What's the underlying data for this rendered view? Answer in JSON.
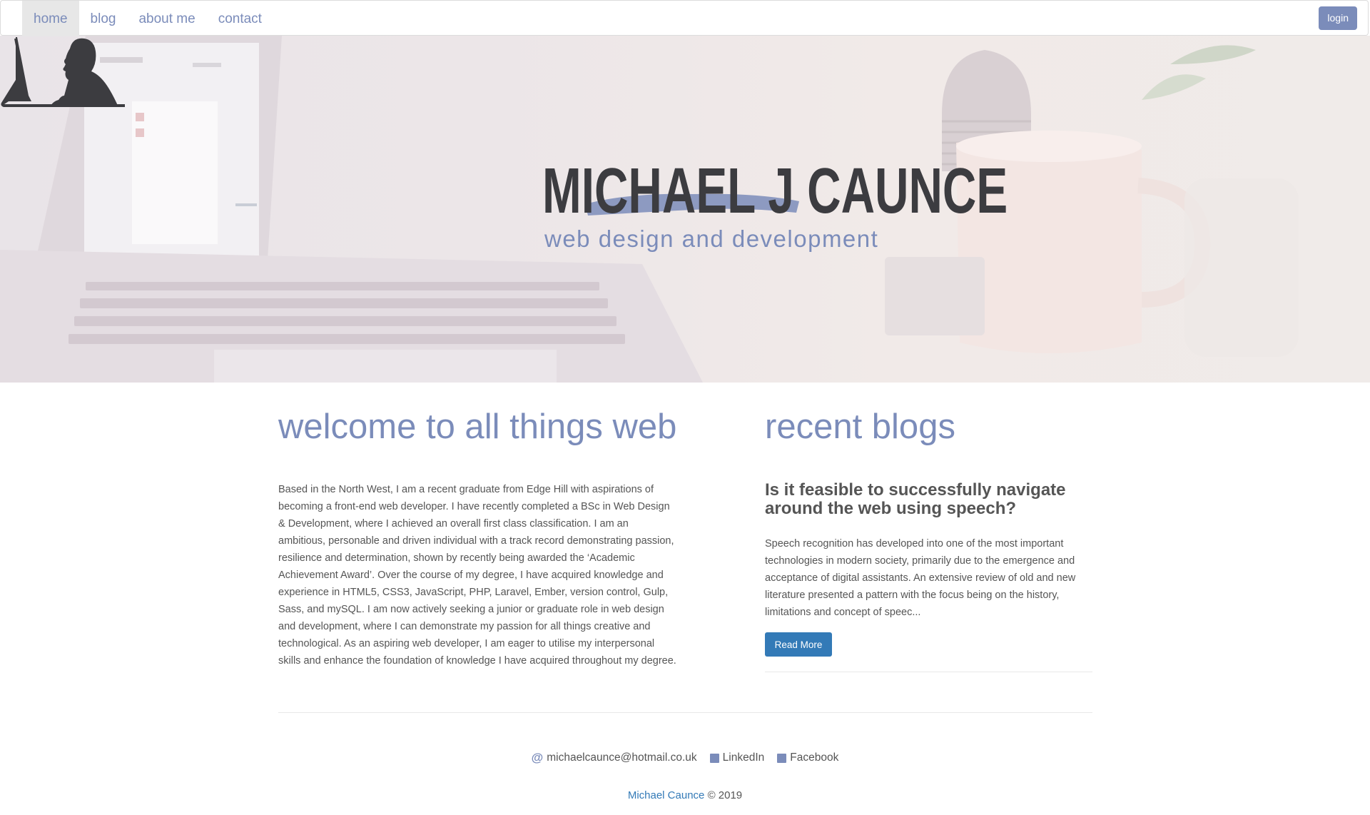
{
  "nav": {
    "items": [
      {
        "label": "home",
        "active": true
      },
      {
        "label": "blog",
        "active": false
      },
      {
        "label": "about me",
        "active": false
      },
      {
        "label": "contact",
        "active": false
      }
    ],
    "login_label": "login"
  },
  "hero": {
    "name": "MICHAEL J CAUNCE",
    "tagline": "web design and development",
    "accent_color": "#7b8cba"
  },
  "welcome": {
    "title": "welcome to all things web",
    "body": "Based in the North West, I am a recent graduate from Edge Hill with aspirations of becoming a front-end web developer. I have recently completed a BSc in Web Design & Development, where I achieved an overall first class classification. I am an ambitious, personable and driven individual with a track record demonstrating passion, resilience and determination, shown by recently being awarded the ‘Academic Achievement Award’. Over the course of my degree, I have acquired knowledge and experience in HTML5, CSS3, JavaScript, PHP, Laravel, Ember, version control, Gulp, Sass, and mySQL. I am now actively seeking a junior or graduate role in web design and development, where I can demonstrate my passion for all things creative and technological. As an aspiring web developer, I am eager to utilise my interpersonal skills and enhance the foundation of knowledge I have acquired throughout my degree."
  },
  "blogs": {
    "title": "recent blogs",
    "post": {
      "title": "Is it feasible to successfully navigate around the web using speech?",
      "excerpt": "Speech recognition has developed into one of the most important technologies in modern society, primarily due to the emergence and acceptance of digital assistants. An extensive review of old and new literature presented a pattern with the focus being on the history, limitations and concept of speec...",
      "read_more_label": "Read More"
    }
  },
  "footer": {
    "email": "michaelcaunce@hotmail.co.uk",
    "linkedin": "LinkedIn",
    "facebook": "Facebook",
    "author": "Michael Caunce",
    "copyright": "© 2019"
  },
  "colors": {
    "accent": "#7b8cba",
    "button_primary": "#337ab7",
    "text": "#555555",
    "logo_dark": "#3c3c40"
  }
}
